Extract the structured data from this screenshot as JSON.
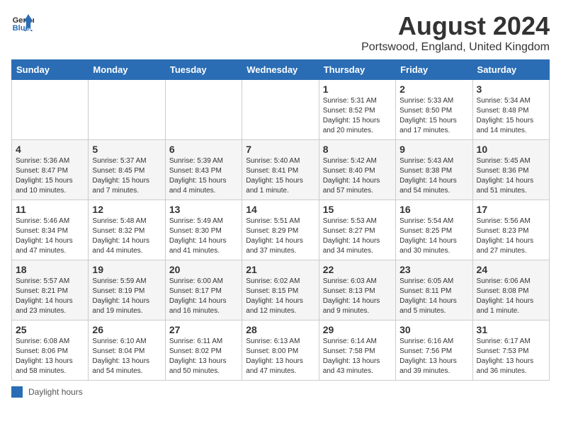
{
  "header": {
    "logo_general": "General",
    "logo_blue": "Blue",
    "month_year": "August 2024",
    "location": "Portswood, England, United Kingdom"
  },
  "days_of_week": [
    "Sunday",
    "Monday",
    "Tuesday",
    "Wednesday",
    "Thursday",
    "Friday",
    "Saturday"
  ],
  "weeks": [
    [
      {
        "day": "",
        "info": ""
      },
      {
        "day": "",
        "info": ""
      },
      {
        "day": "",
        "info": ""
      },
      {
        "day": "",
        "info": ""
      },
      {
        "day": "1",
        "info": "Sunrise: 5:31 AM\nSunset: 8:52 PM\nDaylight: 15 hours and 20 minutes."
      },
      {
        "day": "2",
        "info": "Sunrise: 5:33 AM\nSunset: 8:50 PM\nDaylight: 15 hours and 17 minutes."
      },
      {
        "day": "3",
        "info": "Sunrise: 5:34 AM\nSunset: 8:48 PM\nDaylight: 15 hours and 14 minutes."
      }
    ],
    [
      {
        "day": "4",
        "info": "Sunrise: 5:36 AM\nSunset: 8:47 PM\nDaylight: 15 hours and 10 minutes."
      },
      {
        "day": "5",
        "info": "Sunrise: 5:37 AM\nSunset: 8:45 PM\nDaylight: 15 hours and 7 minutes."
      },
      {
        "day": "6",
        "info": "Sunrise: 5:39 AM\nSunset: 8:43 PM\nDaylight: 15 hours and 4 minutes."
      },
      {
        "day": "7",
        "info": "Sunrise: 5:40 AM\nSunset: 8:41 PM\nDaylight: 15 hours and 1 minute."
      },
      {
        "day": "8",
        "info": "Sunrise: 5:42 AM\nSunset: 8:40 PM\nDaylight: 14 hours and 57 minutes."
      },
      {
        "day": "9",
        "info": "Sunrise: 5:43 AM\nSunset: 8:38 PM\nDaylight: 14 hours and 54 minutes."
      },
      {
        "day": "10",
        "info": "Sunrise: 5:45 AM\nSunset: 8:36 PM\nDaylight: 14 hours and 51 minutes."
      }
    ],
    [
      {
        "day": "11",
        "info": "Sunrise: 5:46 AM\nSunset: 8:34 PM\nDaylight: 14 hours and 47 minutes."
      },
      {
        "day": "12",
        "info": "Sunrise: 5:48 AM\nSunset: 8:32 PM\nDaylight: 14 hours and 44 minutes."
      },
      {
        "day": "13",
        "info": "Sunrise: 5:49 AM\nSunset: 8:30 PM\nDaylight: 14 hours and 41 minutes."
      },
      {
        "day": "14",
        "info": "Sunrise: 5:51 AM\nSunset: 8:29 PM\nDaylight: 14 hours and 37 minutes."
      },
      {
        "day": "15",
        "info": "Sunrise: 5:53 AM\nSunset: 8:27 PM\nDaylight: 14 hours and 34 minutes."
      },
      {
        "day": "16",
        "info": "Sunrise: 5:54 AM\nSunset: 8:25 PM\nDaylight: 14 hours and 30 minutes."
      },
      {
        "day": "17",
        "info": "Sunrise: 5:56 AM\nSunset: 8:23 PM\nDaylight: 14 hours and 27 minutes."
      }
    ],
    [
      {
        "day": "18",
        "info": "Sunrise: 5:57 AM\nSunset: 8:21 PM\nDaylight: 14 hours and 23 minutes."
      },
      {
        "day": "19",
        "info": "Sunrise: 5:59 AM\nSunset: 8:19 PM\nDaylight: 14 hours and 19 minutes."
      },
      {
        "day": "20",
        "info": "Sunrise: 6:00 AM\nSunset: 8:17 PM\nDaylight: 14 hours and 16 minutes."
      },
      {
        "day": "21",
        "info": "Sunrise: 6:02 AM\nSunset: 8:15 PM\nDaylight: 14 hours and 12 minutes."
      },
      {
        "day": "22",
        "info": "Sunrise: 6:03 AM\nSunset: 8:13 PM\nDaylight: 14 hours and 9 minutes."
      },
      {
        "day": "23",
        "info": "Sunrise: 6:05 AM\nSunset: 8:11 PM\nDaylight: 14 hours and 5 minutes."
      },
      {
        "day": "24",
        "info": "Sunrise: 6:06 AM\nSunset: 8:08 PM\nDaylight: 14 hours and 1 minute."
      }
    ],
    [
      {
        "day": "25",
        "info": "Sunrise: 6:08 AM\nSunset: 8:06 PM\nDaylight: 13 hours and 58 minutes."
      },
      {
        "day": "26",
        "info": "Sunrise: 6:10 AM\nSunset: 8:04 PM\nDaylight: 13 hours and 54 minutes."
      },
      {
        "day": "27",
        "info": "Sunrise: 6:11 AM\nSunset: 8:02 PM\nDaylight: 13 hours and 50 minutes."
      },
      {
        "day": "28",
        "info": "Sunrise: 6:13 AM\nSunset: 8:00 PM\nDaylight: 13 hours and 47 minutes."
      },
      {
        "day": "29",
        "info": "Sunrise: 6:14 AM\nSunset: 7:58 PM\nDaylight: 13 hours and 43 minutes."
      },
      {
        "day": "30",
        "info": "Sunrise: 6:16 AM\nSunset: 7:56 PM\nDaylight: 13 hours and 39 minutes."
      },
      {
        "day": "31",
        "info": "Sunrise: 6:17 AM\nSunset: 7:53 PM\nDaylight: 13 hours and 36 minutes."
      }
    ]
  ],
  "footer": {
    "daylight_label": "Daylight hours"
  }
}
